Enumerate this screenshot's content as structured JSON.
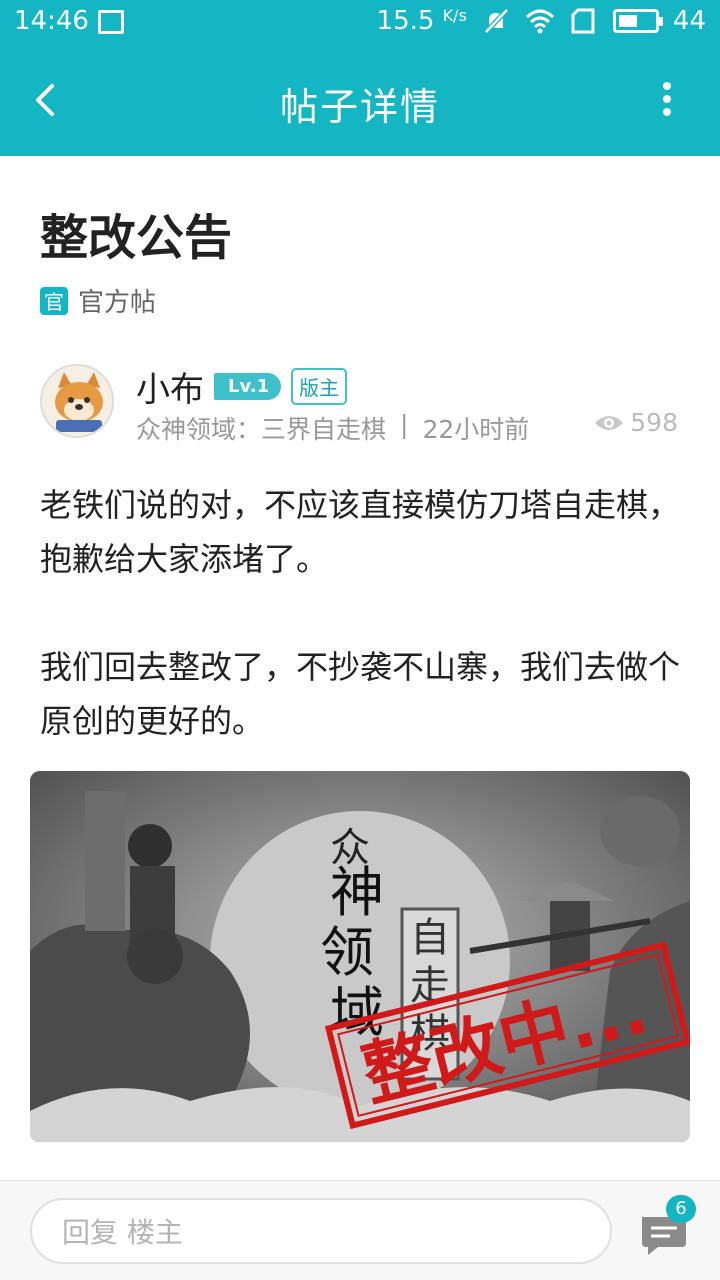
{
  "status_bar": {
    "time": "14:46",
    "net_speed": "15.5",
    "net_unit": "K/s",
    "battery": "44"
  },
  "appbar": {
    "title": "帖子详情"
  },
  "post": {
    "title": "整改公告",
    "official_badge": "官",
    "official_label": "官方帖",
    "author": {
      "name": "小布",
      "level": "Lv.1",
      "role": "版主"
    },
    "forum": "众神领域：三界自走棋",
    "separator": "|",
    "time_ago": "22小时前",
    "views": "598",
    "paragraphs": [
      "老铁们说的对，不应该直接模仿刀塔自走棋，抱歉给大家添堵了。",
      "我们回去整改了，不抄袭不山寨，我们去做个原创的更好的。"
    ],
    "image": {
      "logo_text": "众神领域",
      "sub_text": "自走棋",
      "stamp_text": "整改中..."
    }
  },
  "footer": {
    "reply_placeholder": "回复  楼主",
    "comment_count": "6"
  },
  "colors": {
    "accent": "#14b6c4",
    "stamp": "#d01a1a"
  }
}
